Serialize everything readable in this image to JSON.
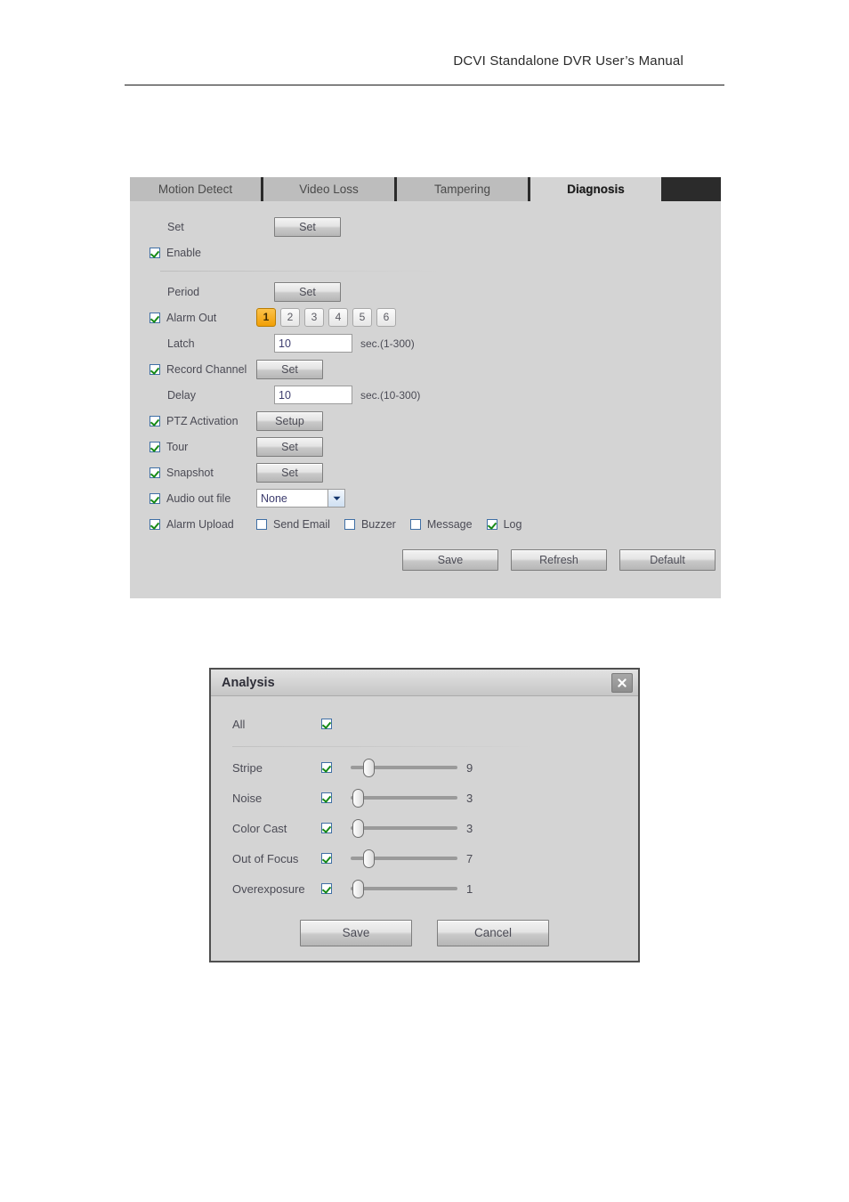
{
  "header": {
    "title": "DCVI Standalone DVR User’s Manual"
  },
  "dvr_panel": {
    "tabs": [
      {
        "label": "Motion Detect",
        "active": false
      },
      {
        "label": "Video Loss",
        "active": false
      },
      {
        "label": "Tampering",
        "active": false
      },
      {
        "label": "Diagnosis",
        "active": true
      }
    ],
    "rows": {
      "set": {
        "label": "Set",
        "button": "Set"
      },
      "enable": {
        "label": "Enable",
        "checked": true
      },
      "period": {
        "label": "Period",
        "button": "Set"
      },
      "alarm_out": {
        "label": "Alarm Out",
        "checked": true,
        "channels": [
          "1",
          "2",
          "3",
          "4",
          "5",
          "6"
        ],
        "selected": "1"
      },
      "latch": {
        "label": "Latch",
        "value": "10",
        "hint": "sec.(1-300)"
      },
      "record_channel": {
        "label": "Record Channel",
        "checked": true,
        "button": "Set"
      },
      "delay": {
        "label": "Delay",
        "value": "10",
        "hint": "sec.(10-300)"
      },
      "ptz_activation": {
        "label": "PTZ Activation",
        "checked": true,
        "button": "Setup"
      },
      "tour": {
        "label": "Tour",
        "checked": true,
        "button": "Set"
      },
      "snapshot": {
        "label": "Snapshot",
        "checked": true,
        "button": "Set"
      },
      "audio_out_file": {
        "label": "Audio out file",
        "checked": true,
        "value": "None"
      },
      "alarm_upload": {
        "label": "Alarm Upload",
        "checked": true,
        "options": [
          {
            "label": "Send Email",
            "checked": false
          },
          {
            "label": "Buzzer",
            "checked": false
          },
          {
            "label": "Message",
            "checked": false
          },
          {
            "label": "Log",
            "checked": true
          }
        ]
      }
    },
    "buttons": {
      "save": "Save",
      "refresh": "Refresh",
      "default": "Default"
    }
  },
  "analysis_dialog": {
    "title": "Analysis",
    "all": {
      "label": "All",
      "checked": true
    },
    "items": [
      {
        "label": "Stripe",
        "checked": true,
        "value": "9",
        "handle_pct": 12
      },
      {
        "label": "Noise",
        "checked": true,
        "value": "3",
        "handle_pct": 2
      },
      {
        "label": "Color Cast",
        "checked": true,
        "value": "3",
        "handle_pct": 2
      },
      {
        "label": "Out of Focus",
        "checked": true,
        "value": "7",
        "handle_pct": 12
      },
      {
        "label": "Overexposure",
        "checked": true,
        "value": "1",
        "handle_pct": 2
      }
    ],
    "buttons": {
      "save": "Save",
      "cancel": "Cancel"
    }
  },
  "colors": {
    "panel_bg": "#d4d4d4",
    "tab_inactive": "#bdbdbd",
    "tab_strip_dark": "#2b2b2b",
    "accent_orange": "#f5a623",
    "check_green": "#168a16",
    "check_border_blue": "#3f6fa5",
    "text": "#4b4b55"
  }
}
